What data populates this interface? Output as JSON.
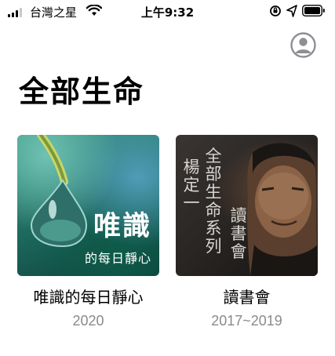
{
  "status_bar": {
    "carrier": "台灣之星",
    "time": "上午9:32"
  },
  "header": {
    "title": "全部生命",
    "profile_icon": "person-circle-icon"
  },
  "albums": [
    {
      "title": "唯識的每日靜心",
      "year": "2020",
      "cover_text_main": "唯識",
      "cover_text_sub": "的每日靜心"
    },
    {
      "title": "讀書會",
      "year": "2017~2019",
      "cover_text_author": "楊定一",
      "cover_text_series": "全部生命系列",
      "cover_text_group": "讀書會"
    }
  ],
  "colors": {
    "accent_gray": "#8a8a8a",
    "icon_gray": "#8e8e93"
  }
}
